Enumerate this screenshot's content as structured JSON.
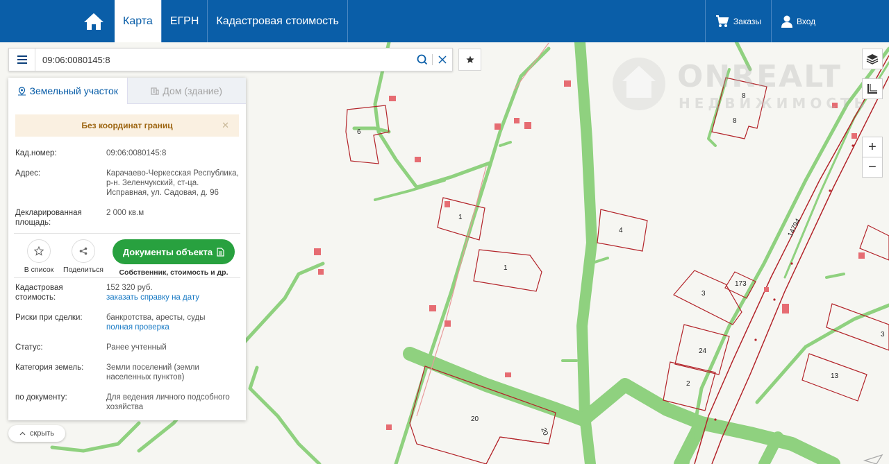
{
  "nav": {
    "tabs": [
      {
        "label": "Карта",
        "active": true
      },
      {
        "label": "ЕГРН",
        "active": false
      },
      {
        "label": "Кадастровая стоимость",
        "active": false
      }
    ],
    "orders_label": "Заказы",
    "login_label": "Вход"
  },
  "watermark": {
    "brand": "ONREALT",
    "sub": "НЕДВИЖИМОСТЬ"
  },
  "search": {
    "value": "09:06:0080145:8"
  },
  "panel": {
    "tabs": [
      {
        "label": "Земельный участок",
        "active": true
      },
      {
        "label": "Дом (здание)",
        "active": false
      }
    ],
    "warning": "Без координат границ",
    "fields": {
      "cad_label": "Кад.номер:",
      "cad_value": "09:06:0080145:8",
      "address_label": "Адрес:",
      "address_value": "Карачаево-Черкесская Республика, р-н. Зеленчукский, ст-ца. Исправная, ул. Садовая, д. 96",
      "area_label": "Декларированная площадь:",
      "area_value": "2 000 кв.м",
      "cost_label": "Кадастровая стоимость:",
      "cost_value": "152 320 руб.",
      "cost_link": "заказать справку на дату",
      "risk_label": "Риски при сделки:",
      "risk_value": "банкротства, аресты, суды",
      "risk_link": "полная проверка",
      "status_label": "Статус:",
      "status_value": "Ранее учтенный",
      "category_label": "Категория земель:",
      "category_value": "Земли поселений (земли населенных пунктов)",
      "doc_label": "по документу:",
      "doc_value": "Для ведения личного подсобного хозяйства"
    },
    "actions": {
      "list_label": "В список",
      "share_label": "Поделиться",
      "docs_button": "Документы объекта",
      "docs_caption": "Собственник, стоимость и др."
    }
  },
  "hide_label": "скрыть",
  "map_labels": [
    "6",
    "1",
    "1",
    "4",
    "8",
    "8",
    "3",
    "173",
    "24",
    "2",
    "13",
    "3",
    "20",
    "20",
    "14794"
  ],
  "colors": {
    "brand": "#0a5ea8",
    "road": "#8fd17f",
    "parcel": "#b3242a",
    "action": "#28a13f"
  }
}
